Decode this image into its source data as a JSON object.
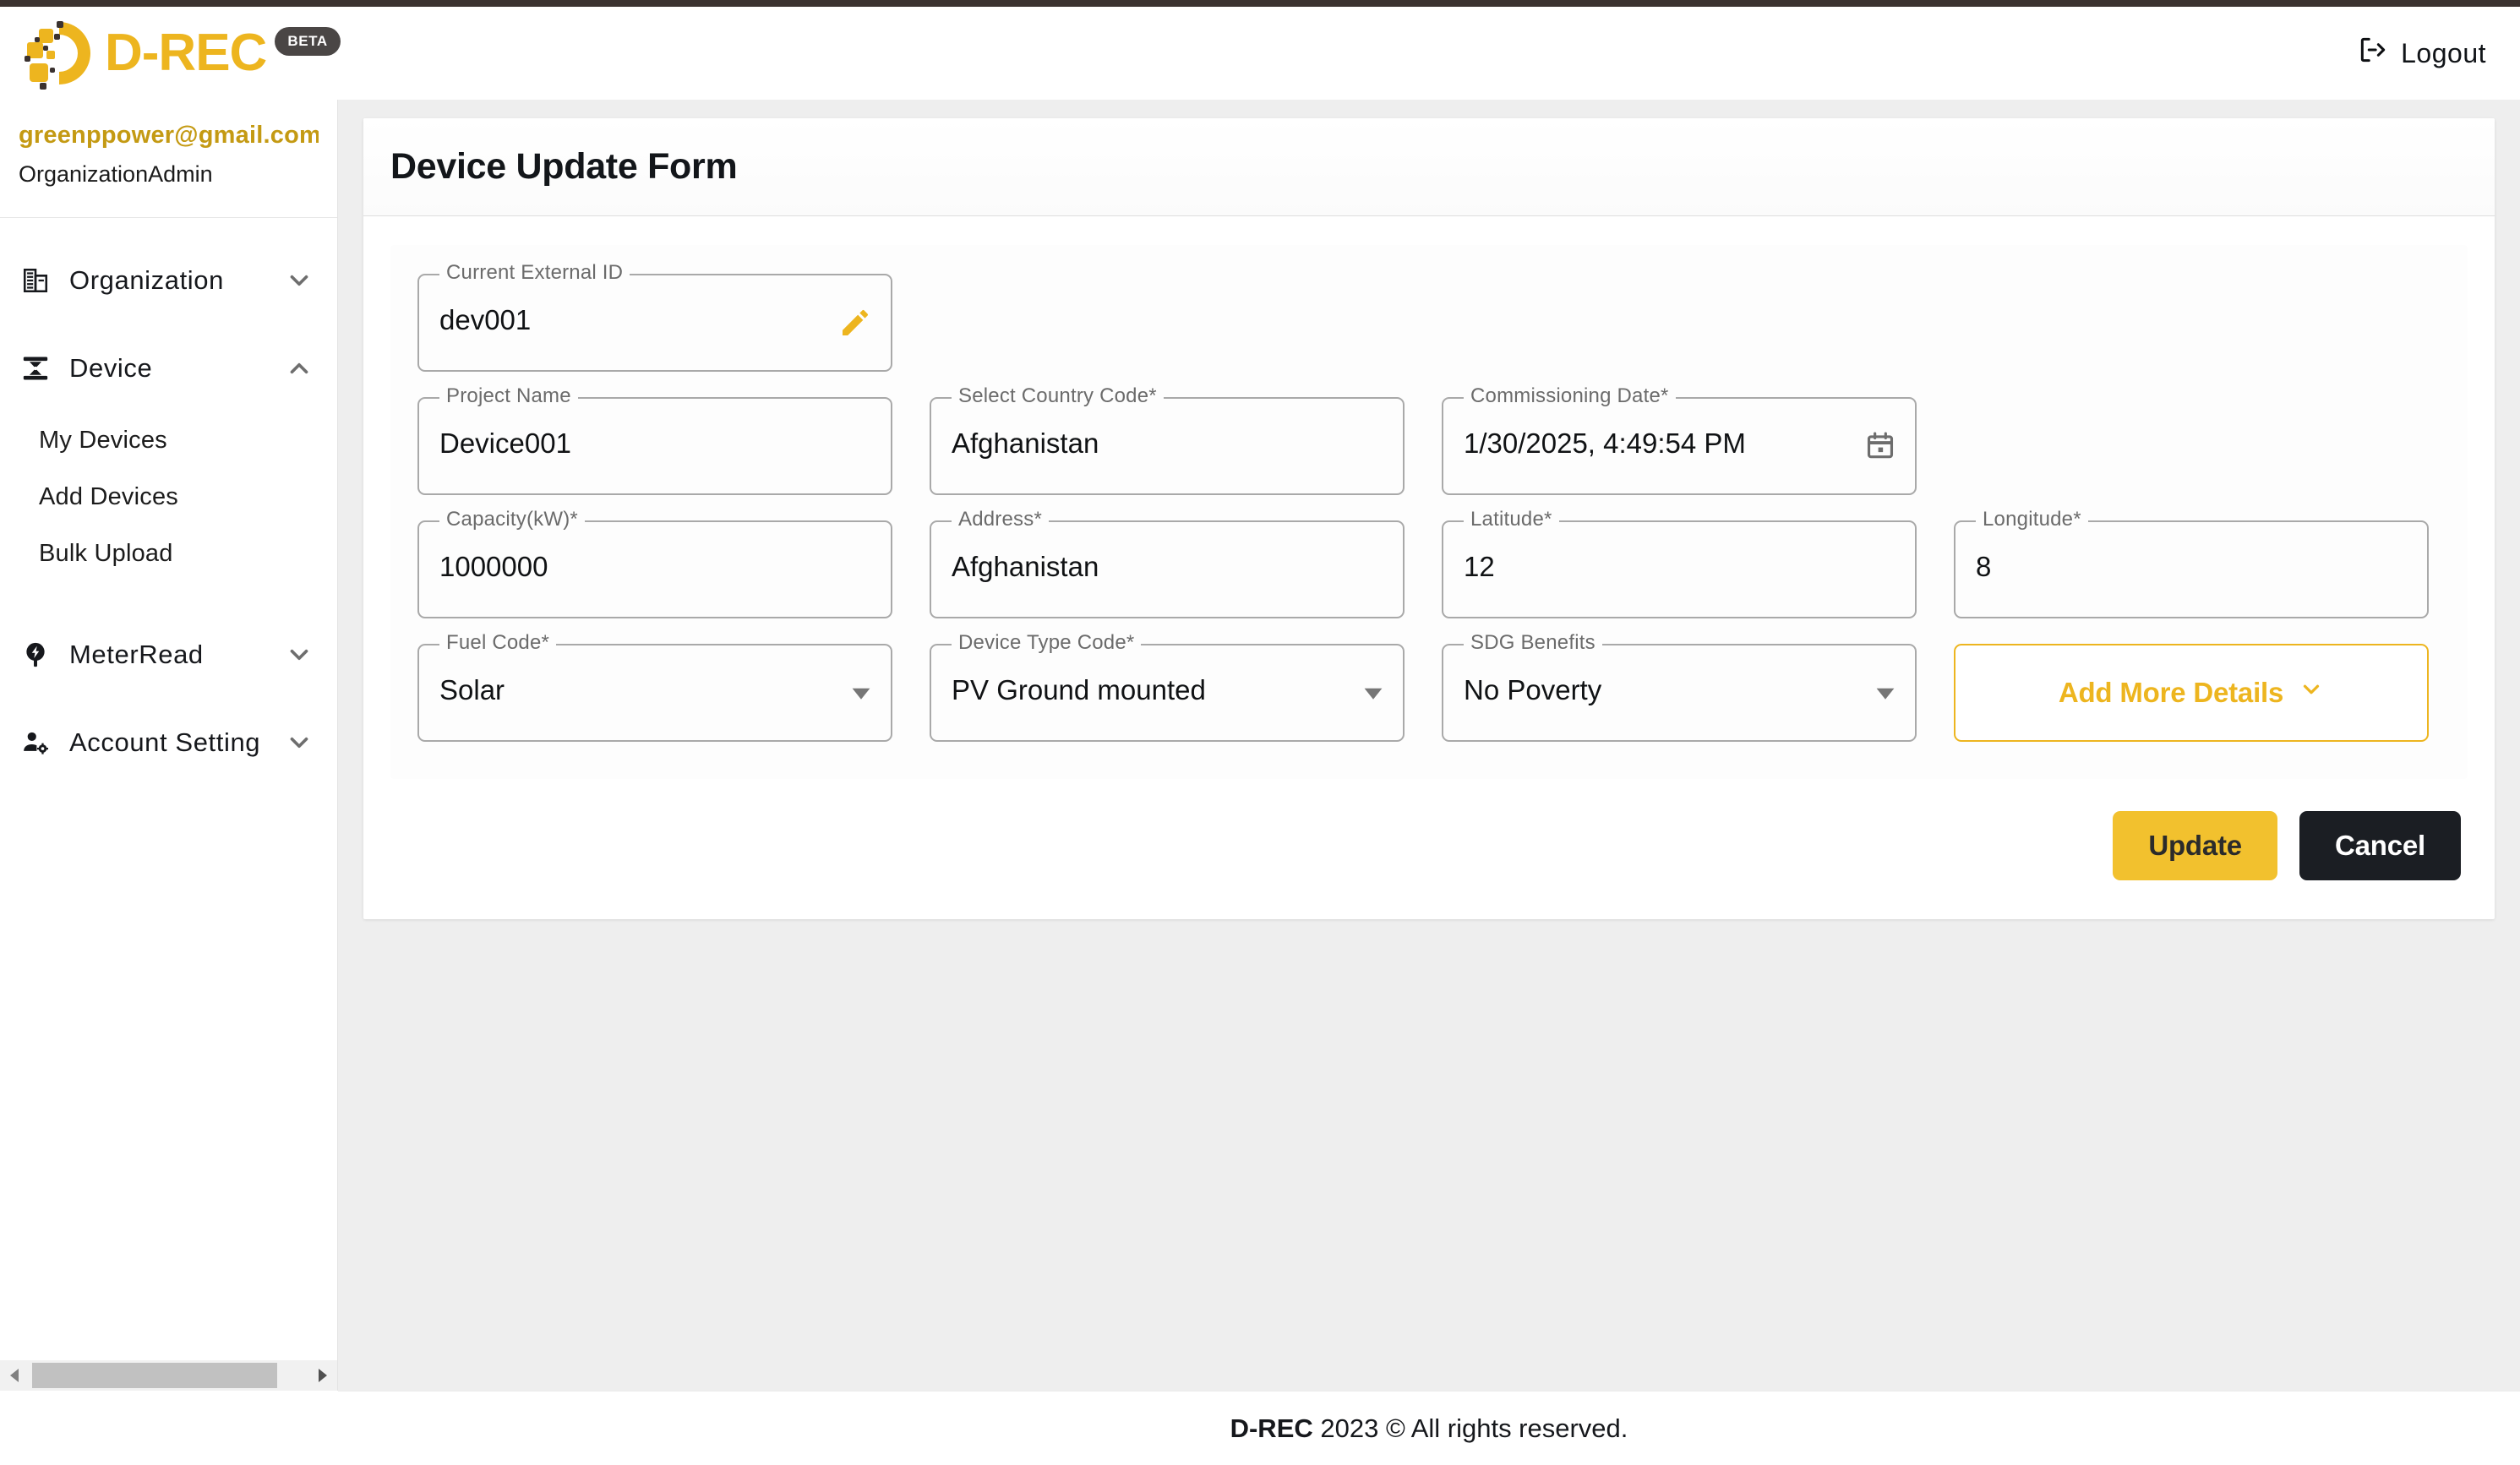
{
  "header": {
    "brand_word": "D-REC",
    "beta_label": "BETA",
    "logout_label": "Logout",
    "logo_icon": "drec-dots-logo-icon",
    "logout_icon": "logout-arrow-icon",
    "accent_color": "#edb51f"
  },
  "sidebar": {
    "user_email": "greenppower@gmail.com",
    "user_role": "OrganizationAdmin",
    "groups": [
      {
        "label": "Organization",
        "icon": "organization-building-icon",
        "chevron": "chevron-down-icon",
        "expanded": false
      },
      {
        "label": "Device",
        "icon": "device-node-icon",
        "chevron": "chevron-up-icon",
        "expanded": true
      },
      {
        "label": "MeterRead",
        "icon": "meter-bolt-icon",
        "chevron": "chevron-down-icon",
        "expanded": false
      },
      {
        "label": "Account Setting",
        "icon": "account-gear-icon",
        "chevron": "chevron-down-icon",
        "expanded": false
      }
    ],
    "device_subitems": [
      {
        "label": "My Devices"
      },
      {
        "label": "Add Devices"
      },
      {
        "label": "Bulk Upload"
      }
    ],
    "scrollbar": {
      "left_arrow_icon": "scroll-left-arrow-icon",
      "right_arrow_icon": "scroll-right-arrow-icon"
    }
  },
  "main": {
    "card_title": "Device Update Form",
    "fields": {
      "external_id": {
        "label": "Current External ID",
        "value": "dev001",
        "trail_icon": "edit-pencil-icon"
      },
      "project_name": {
        "label": "Project Name",
        "value": "Device001"
      },
      "country_code": {
        "label": "Select Country Code*",
        "value": "Afghanistan"
      },
      "commissioning_date": {
        "label": "Commissioning Date*",
        "value": "1/30/2025, 4:49:54 PM",
        "trail_icon": "calendar-icon"
      },
      "capacity": {
        "label": "Capacity(kW)*",
        "value": "1000000"
      },
      "address": {
        "label": "Address*",
        "value": "Afghanistan"
      },
      "latitude": {
        "label": "Latitude*",
        "value": "12"
      },
      "longitude": {
        "label": "Longitude*",
        "value": "8"
      },
      "fuel_code": {
        "label": "Fuel Code*",
        "value": "Solar",
        "trail_icon": "dropdown-caret-icon"
      },
      "device_type_code": {
        "label": "Device Type Code*",
        "value": "PV Ground mounted",
        "trail_icon": "dropdown-caret-icon"
      },
      "sdg_benefits": {
        "label": "SDG Benefits",
        "value": "No Poverty",
        "trail_icon": "dropdown-caret-icon"
      }
    },
    "add_more_details": {
      "label": "Add More Details",
      "icon": "chevron-down-icon"
    },
    "buttons": {
      "update": "Update",
      "cancel": "Cancel"
    }
  },
  "footer": {
    "brand": "D-REC",
    "text": " 2023 © All rights reserved."
  }
}
